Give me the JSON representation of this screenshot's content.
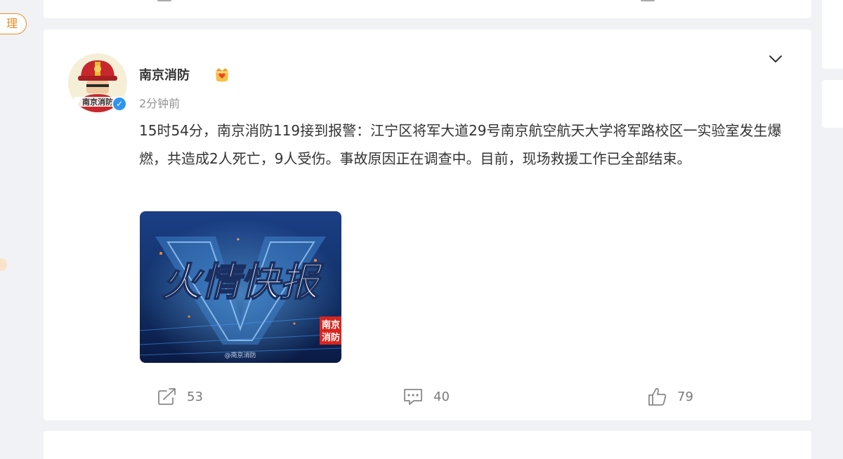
{
  "sidebar": {
    "partial_button_label": "理"
  },
  "post": {
    "author": {
      "name": "南京消防",
      "avatar_text": "南京消防"
    },
    "timestamp": "2分钟前",
    "text": "15时54分，南京消防119接到报警：江宁区将军大道29号南京航空航天大学将军路校区一实验室发生爆燃，共造成2人死亡，9人受伤。事故原因正在调查中。目前，现场救援工作已全部结束。",
    "image": {
      "headline": "火情快报",
      "corner_label_line1": "南京",
      "corner_label_line2": "消防",
      "watermark": "@南京消防"
    },
    "actions": {
      "share": {
        "icon": "share-icon",
        "count": "53"
      },
      "comment": {
        "icon": "comment-icon",
        "count": "40"
      },
      "like": {
        "icon": "like-icon",
        "count": "79"
      }
    }
  },
  "colors": {
    "accent_orange": "#f08a24",
    "verified_blue": "#2f93f0",
    "text_primary": "#333333",
    "text_secondary": "#939393",
    "background": "#f1f2f5"
  }
}
